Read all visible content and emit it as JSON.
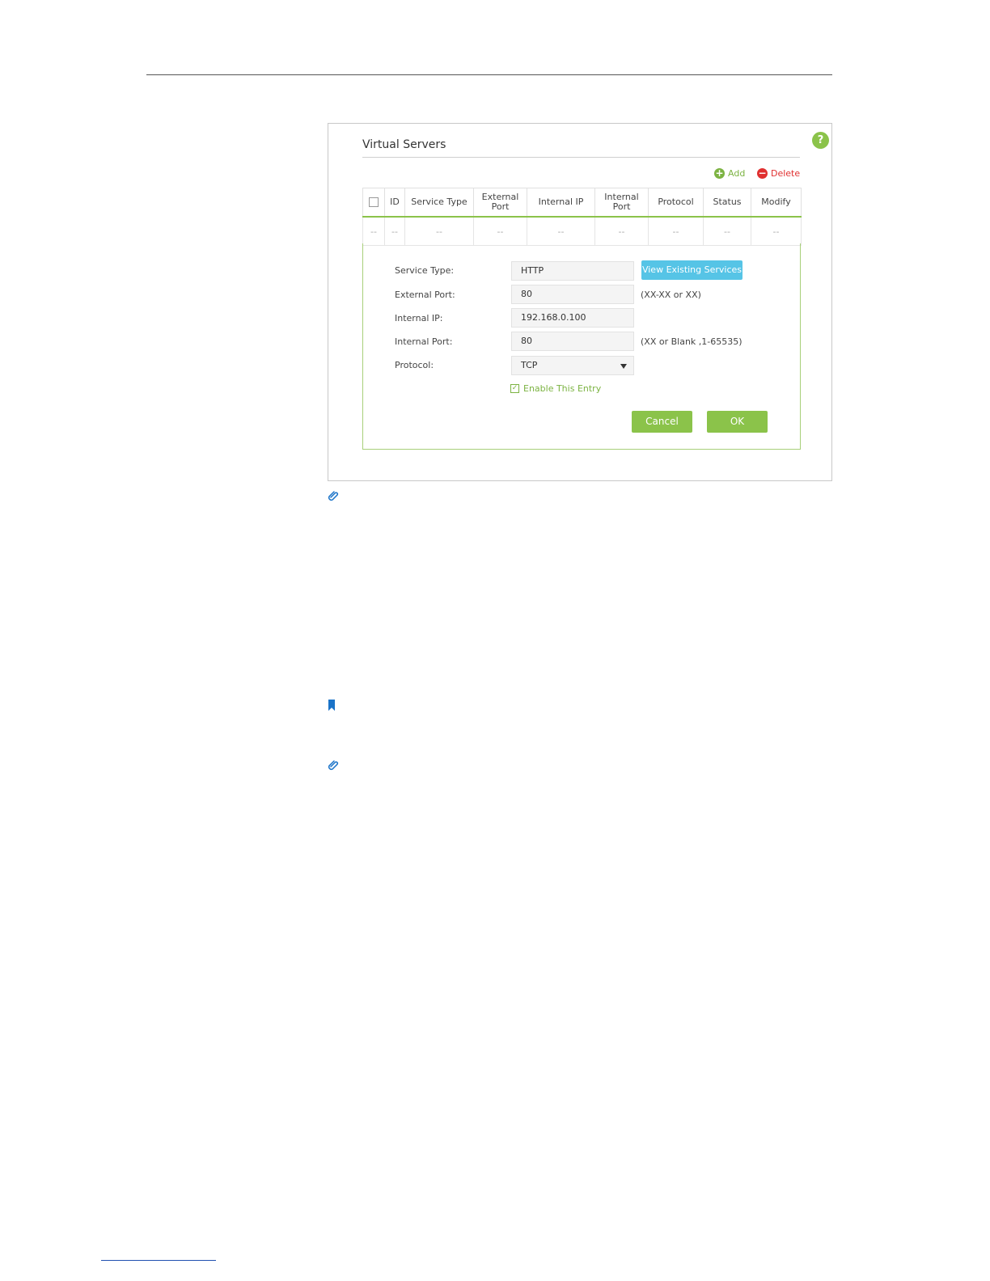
{
  "panel": {
    "title": "Virtual Servers",
    "help_icon": "?",
    "add_label": "Add",
    "delete_label": "Delete"
  },
  "table": {
    "headers": [
      "",
      "ID",
      "Service Type",
      "External\nPort",
      "Internal IP",
      "Internal Port",
      "Protocol",
      "Status",
      "Modify"
    ],
    "row": [
      "--",
      "--",
      "--",
      "--",
      "--",
      "--",
      "--",
      "--",
      "--"
    ]
  },
  "form": {
    "service_type_label": "Service Type:",
    "service_type_value": "HTTP",
    "view_services_label": "View Existing Services",
    "external_port_label": "External Port:",
    "external_port_value": "80",
    "external_port_hint": "(XX-XX or XX)",
    "internal_ip_label": "Internal IP:",
    "internal_ip_value": "192.168.0.100",
    "internal_port_label": "Internal Port:",
    "internal_port_value": "80",
    "internal_port_hint": "(XX or Blank ,1-65535)",
    "protocol_label": "Protocol:",
    "protocol_value": "TCP",
    "enable_label": "Enable This Entry",
    "enable_checked": true,
    "cancel_label": "Cancel",
    "ok_label": "OK"
  },
  "icons": {
    "note_1": "paperclip-icon",
    "bookmark": "bookmark-icon",
    "note_2": "paperclip-icon"
  },
  "colors": {
    "accent_green": "#8bc34a",
    "info_blue": "#56c4e6",
    "delete_red": "#e03030",
    "icon_blue": "#1a73c8"
  }
}
